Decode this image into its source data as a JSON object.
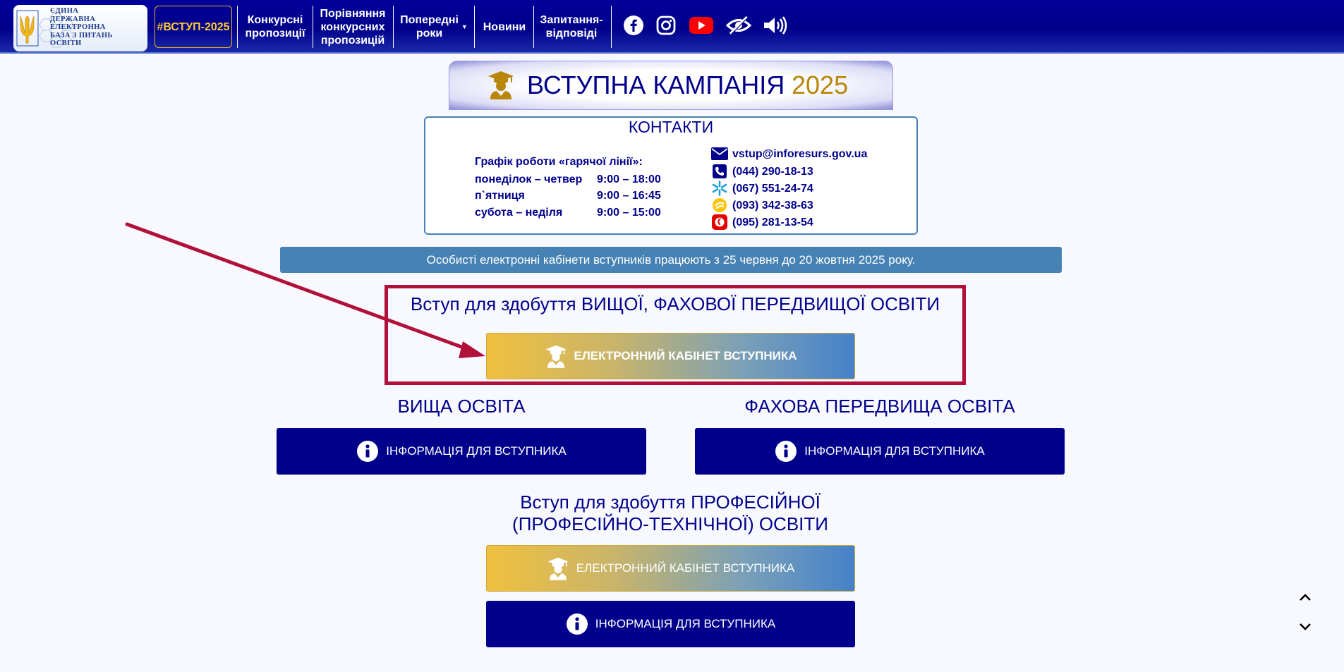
{
  "logo": {
    "lines": [
      "ЄДИНА",
      "ДЕРЖАВНА",
      "ЕЛЕКТРОННА",
      "БАЗА З ПИТАНЬ",
      "ОСВІТИ"
    ]
  },
  "nav": {
    "vstup": "#ВСТУП-2025",
    "konkursni": [
      "Конкурсні",
      "пропозиції"
    ],
    "porivnyannya": [
      "Порівняння",
      "конкурсних",
      "пропозицій"
    ],
    "poperedni": [
      "Попередні",
      "роки"
    ],
    "novyny": "Новини",
    "zapytannya": [
      "Запитання-",
      "відповіді"
    ]
  },
  "social_icons": [
    "facebook-icon",
    "instagram-icon",
    "youtube-icon",
    "low-vision-icon",
    "sound-icon"
  ],
  "banner": {
    "title": "ВСТУПНА КАМПАНІЯ",
    "year": "2025"
  },
  "contacts": {
    "title": "КОНТАКТИ",
    "schedule_title": "Графік роботи «гарячої лінії»:",
    "schedule": [
      {
        "days": "понеділок – четвер",
        "hours": "9:00 – 18:00"
      },
      {
        "days": "п`ятниця",
        "hours": "9:00 – 16:45"
      },
      {
        "days": "субота – неділя",
        "hours": "9:00 – 15:00"
      }
    ],
    "email": "vstup@inforesurs.gov.ua",
    "phones": [
      "(044) 290-18-13",
      "(067) 551-24-74",
      "(093) 342-38-63",
      "(095) 281-13-54"
    ]
  },
  "notice": "Особисті електронні кабінети вступників працюють з 25 червня до 20 жовтня 2025 року.",
  "higher_section": {
    "title": "Вступ для здобуття ВИЩОЇ, ФАХОВОЇ ПЕРЕДВИЩОЇ ОСВІТИ",
    "cabinet_button": "ЕЛЕКТРОННИЙ КАБІНЕТ ВСТУПНИКА"
  },
  "higher_education": {
    "title": "ВИЩА ОСВІТА",
    "info_button": "ІНФОРМАЦІЯ ДЛЯ ВСТУПНИКА"
  },
  "pre_higher_education": {
    "title": "ФАХОВА ПЕРЕДВИЩА ОСВІТА",
    "info_button": "ІНФОРМАЦІЯ ДЛЯ ВСТУПНИКА"
  },
  "vocational_section": {
    "title_lines": [
      "Вступ для здобуття ПРОФЕСІЙНОЇ",
      "(ПРОФЕСІЙНО-ТЕХНІЧНОЇ) ОСВІТИ"
    ],
    "cabinet_button": "ЕЛЕКТРОННИЙ КАБІНЕТ ВСТУПНИКА",
    "info_button": "ІНФОРМАЦІЯ ДЛЯ ВСТУПНИКА"
  },
  "colors": {
    "navy": "#00008b",
    "gold": "#b8860b",
    "nav_active": "#ffcc33",
    "notice_bg": "#4682b4",
    "highlight_border": "#b0103a"
  }
}
